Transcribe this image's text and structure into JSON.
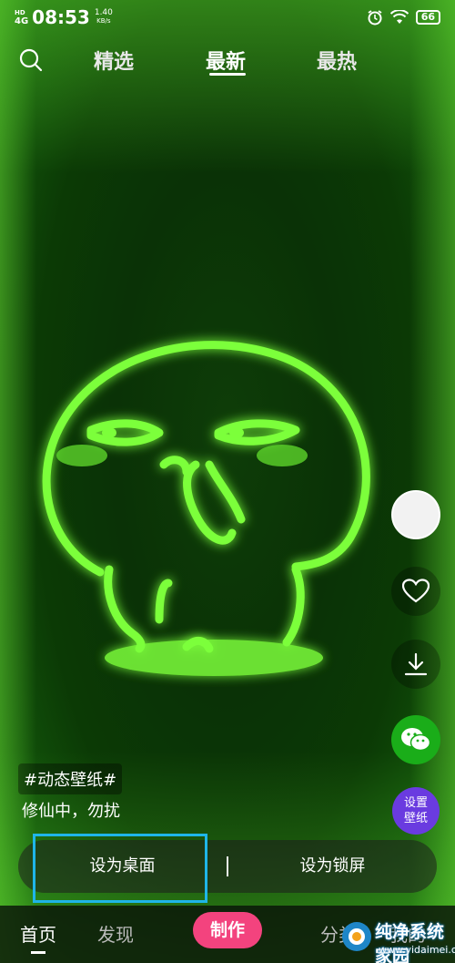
{
  "status_bar": {
    "network": "4G",
    "network_sup": "HD",
    "time": "08:53",
    "speed_value": "1.40",
    "speed_unit": "KB/s",
    "battery": "66"
  },
  "top_tabs": [
    {
      "label": "精选"
    },
    {
      "label": "最新",
      "active": true
    },
    {
      "label": "最热"
    }
  ],
  "content": {
    "tag": "#动态壁纸#",
    "description": "修仙中，勿扰"
  },
  "actions": {
    "set_wallpaper": "设置壁纸",
    "set_wallpaper_line1": "设置",
    "set_wallpaper_line2": "壁纸"
  },
  "set_bar": {
    "desktop": "设为桌面",
    "lockscreen": "设为锁屏"
  },
  "bottom_nav": {
    "home": "首页",
    "discover": "发现",
    "make": "制作",
    "share": "分类",
    "mine": "我的"
  },
  "watermark": {
    "name": "纯净系统家园",
    "url": "www.yidaimei.com"
  },
  "colors": {
    "neon_green": "#7cff3a",
    "make_button": "#f3437e",
    "set_wallpaper_button": "#6a3be0",
    "wechat": "#1aad19",
    "highlight": "#1fb5e8"
  }
}
